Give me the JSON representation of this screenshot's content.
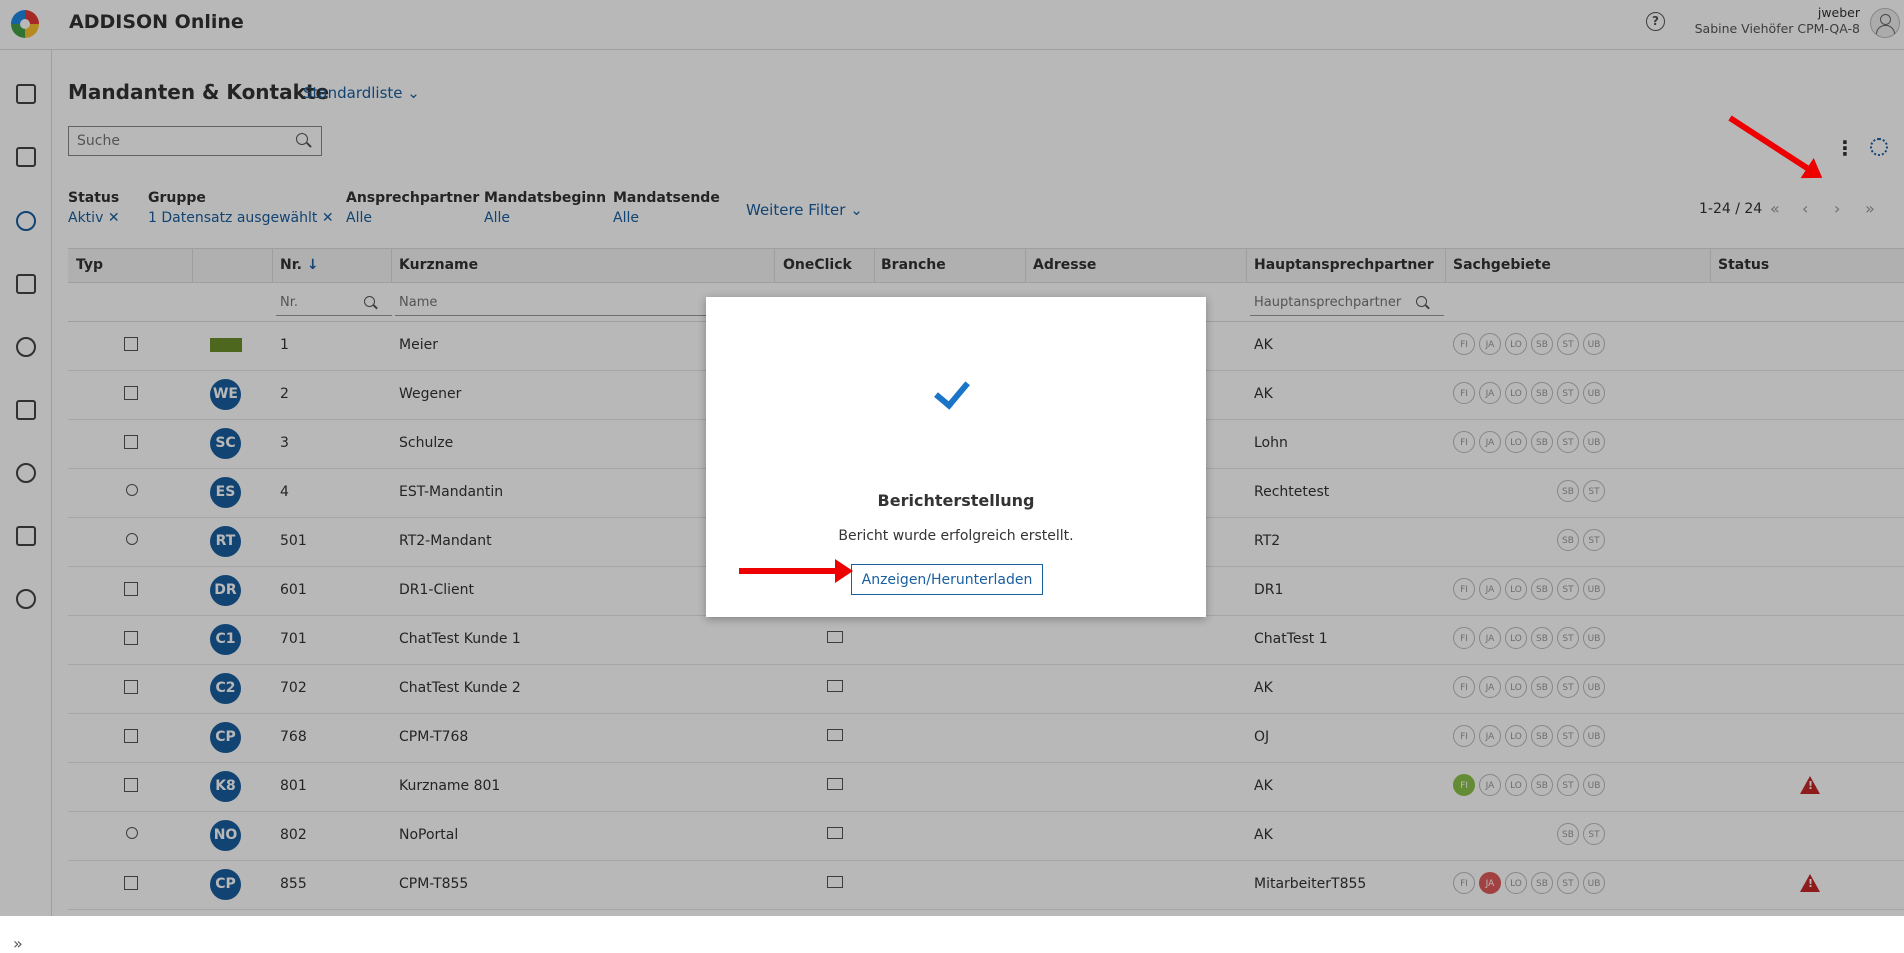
{
  "app": {
    "title": "ADDISON Online"
  },
  "user": {
    "login": "jweber",
    "name": "Sabine Viehöfer CPM-QA-8"
  },
  "page": {
    "title": "Mandanten & Kontakte",
    "view": "Standardliste"
  },
  "search": {
    "placeholder": "Suche"
  },
  "filters": [
    {
      "label": "Status",
      "value": "Aktiv",
      "clearable": true
    },
    {
      "label": "Gruppe",
      "value": "1 Datensatz ausgewählt",
      "clearable": true
    },
    {
      "label": "Ansprechpartner",
      "value": "Alle"
    },
    {
      "label": "Mandatsbeginn",
      "value": "Alle"
    },
    {
      "label": "Mandatsende",
      "value": "Alle"
    }
  ],
  "more_filters": "Weitere Filter",
  "pager": {
    "text": "1-24 / 24"
  },
  "columns": [
    "Typ",
    "",
    "Nr.",
    "Kurzname",
    "OneClick",
    "Branche",
    "Adresse",
    "Hauptansprechpartner",
    "Sachgebiete",
    "Status"
  ],
  "column_filters": {
    "nr": "Nr.",
    "name": "Name",
    "contact": "Hauptansprechpartner"
  },
  "rows": [
    {
      "type": "company",
      "badge": "",
      "logo": true,
      "nr": "1",
      "name": "Meier",
      "oneclick": false,
      "contact": "AK",
      "chips": [
        "FI",
        "JA",
        "LO",
        "SB",
        "ST",
        "UB"
      ],
      "warn": false
    },
    {
      "type": "company",
      "badge": "WE",
      "nr": "2",
      "name": "Wegener",
      "oneclick": false,
      "contact": "AK",
      "chips": [
        "FI",
        "JA",
        "LO",
        "SB",
        "ST",
        "UB"
      ],
      "warn": false
    },
    {
      "type": "company",
      "badge": "SC",
      "nr": "3",
      "name": "Schulze",
      "oneclick": false,
      "contact": "Lohn",
      "chips": [
        "FI",
        "JA",
        "LO",
        "SB",
        "ST",
        "UB"
      ],
      "warn": false
    },
    {
      "type": "person",
      "badge": "ES",
      "nr": "4",
      "name": "EST-Mandantin",
      "oneclick": false,
      "contact": "Rechtetest",
      "chips": [
        "SB",
        "ST"
      ],
      "warn": false
    },
    {
      "type": "person",
      "badge": "RT",
      "nr": "501",
      "name": "RT2-Mandant",
      "oneclick": false,
      "contact": "RT2",
      "chips": [
        "SB",
        "ST"
      ],
      "warn": false
    },
    {
      "type": "company",
      "badge": "DR",
      "nr": "601",
      "name": "DR1-Client",
      "oneclick": false,
      "contact": "DR1",
      "chips": [
        "FI",
        "JA",
        "LO",
        "SB",
        "ST",
        "UB"
      ],
      "warn": false
    },
    {
      "type": "company",
      "badge": "C1",
      "nr": "701",
      "name": "ChatTest Kunde 1",
      "oneclick": true,
      "contact": "ChatTest 1",
      "chips": [
        "FI",
        "JA",
        "LO",
        "SB",
        "ST",
        "UB"
      ],
      "warn": false
    },
    {
      "type": "company",
      "badge": "C2",
      "nr": "702",
      "name": "ChatTest Kunde 2",
      "oneclick": true,
      "contact": "AK",
      "chips": [
        "FI",
        "JA",
        "LO",
        "SB",
        "ST",
        "UB"
      ],
      "warn": false
    },
    {
      "type": "company",
      "badge": "CP",
      "nr": "768",
      "name": "CPM-T768",
      "oneclick": true,
      "contact": "OJ",
      "chips": [
        "FI",
        "JA",
        "LO",
        "SB",
        "ST",
        "UB"
      ],
      "warn": false
    },
    {
      "type": "company",
      "badge": "K8",
      "nr": "801",
      "name": "Kurzname 801",
      "oneclick": true,
      "contact": "AK",
      "chips": [
        "FI",
        "JA",
        "LO",
        "SB",
        "ST",
        "UB"
      ],
      "chip_green": "FI",
      "warn": true
    },
    {
      "type": "person",
      "badge": "NO",
      "nr": "802",
      "name": "NoPortal",
      "oneclick": true,
      "contact": "AK",
      "chips": [
        "SB",
        "ST"
      ],
      "warn": false
    },
    {
      "type": "company",
      "badge": "CP",
      "nr": "855",
      "name": "CPM-T855",
      "oneclick": true,
      "contact": "MitarbeiterT855",
      "chips": [
        "FI",
        "JA",
        "LO",
        "SB",
        "ST",
        "UB"
      ],
      "chip_red": "JA",
      "warn": true
    }
  ],
  "modal": {
    "title": "Berichterstellung",
    "message": "Bericht wurde erfolgreich erstellt.",
    "button": "Anzeigen/Herunterladen"
  },
  "colors": {
    "accent": "#1a5fa0",
    "warning": "#c62828",
    "annotation_arrow": "#e00000"
  }
}
